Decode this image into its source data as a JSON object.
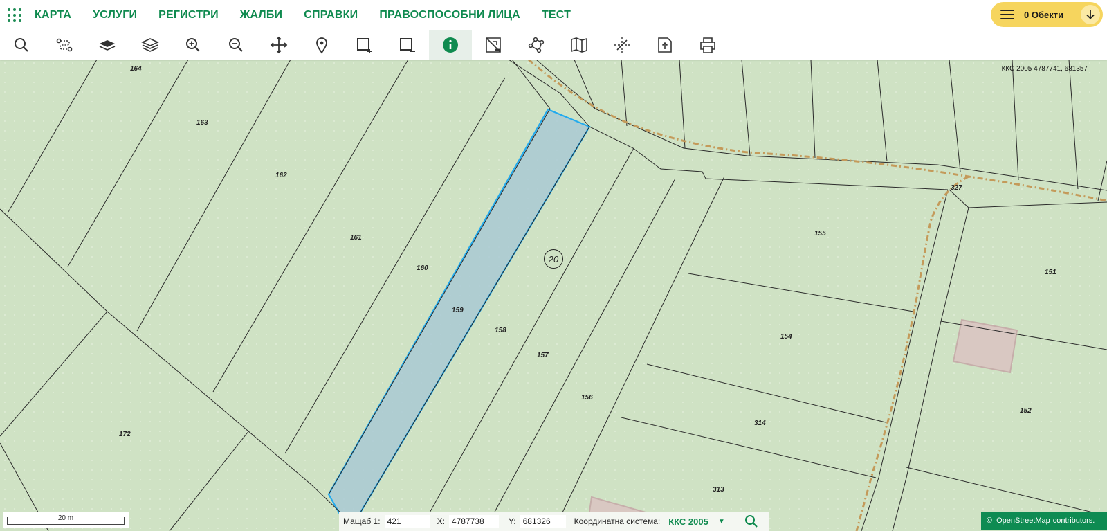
{
  "header": {
    "menu": [
      "КАРТА",
      "УСЛУГИ",
      "РЕГИСТРИ",
      "ЖАЛБИ",
      "СПРАВКИ",
      "ПРАВОСПОСОБНИ ЛИЦА",
      "ТЕСТ"
    ],
    "objects_label": "0 Обекти"
  },
  "toolbar": {
    "tools": [
      "search-icon",
      "route-icon",
      "layer-icon",
      "layers-icon",
      "zoom-in-icon",
      "zoom-out-icon",
      "pan-icon",
      "location-pin-icon",
      "select-add-icon",
      "select-remove-icon",
      "info-icon",
      "measure-icon",
      "polygon-icon",
      "map-icon",
      "crosshair-icon",
      "export-icon",
      "print-icon"
    ],
    "active_tool": "info-icon"
  },
  "map": {
    "coord_readout": "ККС 2005 4787741, 681357",
    "parcels": [
      "164",
      "163",
      "162",
      "161",
      "160",
      "159",
      "158",
      "157",
      "156",
      "155",
      "154",
      "151",
      "152",
      "172",
      "314",
      "313",
      "327"
    ],
    "house_number": "20"
  },
  "footer": {
    "scale_text": "20 m",
    "scale_label": "Мащаб 1:",
    "scale_value": "421",
    "x_label": "X:",
    "x_value": "4787738",
    "y_label": "Y:",
    "y_value": "681326",
    "crs_label": "Координатна система:",
    "crs_value": "ККС 2005",
    "attribution_symbol": "©",
    "attribution_brand": "OpenStreetMap",
    "attribution_text": "contributors."
  },
  "colors": {
    "accent": "#0f8a4f",
    "map_bg": "#cfe2c4",
    "selected_fill": "#a9c9d4",
    "selected_stroke": "#22aaee",
    "trail": "#c49a5a",
    "objects_button": "#f6d55e"
  }
}
